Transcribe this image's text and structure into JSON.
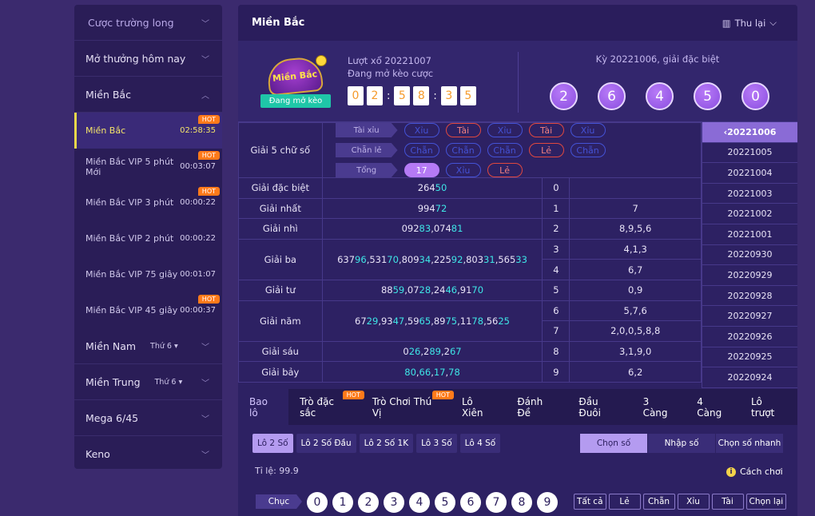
{
  "sidebar": {
    "top": "Cược trường long",
    "sections": [
      {
        "label": "Mở thưởng hôm nay"
      },
      {
        "label": "Miền Bắc"
      }
    ],
    "items": [
      {
        "name": "Miền Bắc",
        "time": "02:58:35",
        "hot": "HOT"
      },
      {
        "name": "Miền Bắc VIP 5 phút Mới",
        "time": "00:03:07",
        "hot": "HOT"
      },
      {
        "name": "Miền Bắc VIP 3 phút",
        "time": "00:00:22",
        "hot": "HOT"
      },
      {
        "name": "Miền Bắc VIP 2 phút",
        "time": "00:00:22",
        "hot": ""
      },
      {
        "name": "Miền Bắc VIP 75 giây",
        "time": "00:01:07",
        "hot": ""
      },
      {
        "name": "Miền Bắc VIP 45 giây",
        "time": "00:00:37",
        "hot": "HOT"
      }
    ],
    "bottom": [
      {
        "label": "Miền Nam",
        "dropdown": "Thứ 6"
      },
      {
        "label": "Miền Trung",
        "dropdown": "Thứ 6"
      },
      {
        "label": "Mega 6/45",
        "dropdown": ""
      },
      {
        "label": "Keno",
        "dropdown": ""
      }
    ]
  },
  "header": {
    "title": "Miền Bắc",
    "collapse": "Thu lại"
  },
  "draw": {
    "logo_text": "Miền Bắc",
    "open_label": "Đang mở kèo",
    "round": "Lượt xổ 20221007",
    "status": "Đang mở kèo cược",
    "countdown": [
      "0",
      "2",
      "5",
      "8",
      "3",
      "5"
    ],
    "prev_title": "Kỳ 20221006, giải đặc biệt",
    "prev_balls": [
      "2",
      "6",
      "4",
      "5",
      "0"
    ]
  },
  "g5": {
    "label": "Giải 5 chữ số",
    "rows": [
      {
        "label": "Tài xỉu",
        "chips": [
          {
            "t": "Xỉu",
            "c": "blue"
          },
          {
            "t": "Tài",
            "c": "red"
          },
          {
            "t": "Xỉu",
            "c": "blue"
          },
          {
            "t": "Tài",
            "c": "red"
          },
          {
            "t": "Xỉu",
            "c": "blue"
          }
        ]
      },
      {
        "label": "Chẵn lẻ",
        "chips": [
          {
            "t": "Chẵn",
            "c": "blue"
          },
          {
            "t": "Chẵn",
            "c": "blue"
          },
          {
            "t": "Chẵn",
            "c": "blue"
          },
          {
            "t": "Lẻ",
            "c": "red"
          },
          {
            "t": "Chẵn",
            "c": "blue"
          }
        ]
      },
      {
        "label": "Tổng",
        "chips": [
          {
            "t": "17",
            "c": "fill"
          },
          {
            "t": "Xỉu",
            "c": "blue"
          },
          {
            "t": "Lẻ",
            "c": "red"
          }
        ]
      }
    ]
  },
  "prizes": [
    {
      "label": "Giải đặc biệt",
      "parts": [
        [
          "264",
          "50"
        ]
      ],
      "rows": [
        {
          "d": "0",
          "t": ""
        }
      ]
    },
    {
      "label": "Giải nhất",
      "parts": [
        [
          "994",
          "72"
        ]
      ],
      "rows": [
        {
          "d": "1",
          "t": "7"
        }
      ]
    },
    {
      "label": "Giải nhì",
      "parts": [
        [
          "092",
          "83"
        ],
        [
          "074",
          "81"
        ]
      ],
      "rows": [
        {
          "d": "2",
          "t": "8,9,5,6"
        }
      ]
    },
    {
      "label": "Giải ba",
      "parts": [
        [
          "637",
          "96"
        ],
        [
          "531",
          "70"
        ],
        [
          "809",
          "34"
        ],
        [
          "225",
          "92"
        ],
        [
          "803",
          "31"
        ],
        [
          "565",
          "33"
        ]
      ],
      "rows": [
        {
          "d": "3",
          "t": "4,1,3"
        },
        {
          "d": "4",
          "t": "6,7"
        }
      ]
    },
    {
      "label": "Giải tư",
      "parts": [
        [
          "88",
          "59"
        ],
        [
          "07",
          "28"
        ],
        [
          "24",
          "46"
        ],
        [
          "91",
          "70"
        ]
      ],
      "rows": [
        {
          "d": "5",
          "t": "0,9"
        }
      ]
    },
    {
      "label": "Giải năm",
      "parts": [
        [
          "67",
          "29"
        ],
        [
          "93",
          "47"
        ],
        [
          "59",
          "65"
        ],
        [
          "89",
          "75"
        ],
        [
          "11",
          "78"
        ],
        [
          "56",
          "25"
        ]
      ],
      "rows": [
        {
          "d": "6",
          "t": "5,7,6"
        },
        {
          "d": "7",
          "t": "2,0,0,5,8,8"
        }
      ]
    },
    {
      "label": "Giải sáu",
      "parts": [
        [
          "0",
          "26"
        ],
        [
          "2",
          "89"
        ],
        [
          "2",
          "67"
        ]
      ],
      "rows": [
        {
          "d": "8",
          "t": "3,1,9,0"
        }
      ]
    },
    {
      "label": "Giải bảy",
      "parts": [
        [
          "",
          "80"
        ],
        [
          "",
          "66"
        ],
        [
          "",
          "17"
        ],
        [
          "",
          "78"
        ]
      ],
      "rows": [
        {
          "d": "9",
          "t": "6,2"
        }
      ]
    }
  ],
  "periods": [
    "20221006",
    "20221005",
    "20221004",
    "20221003",
    "20221002",
    "20221001",
    "20220930",
    "20220929",
    "20220928",
    "20220927",
    "20220926",
    "20220925",
    "20220924"
  ],
  "tabs": [
    {
      "label": "Bao lô",
      "hot": ""
    },
    {
      "label": "Trò đặc sắc",
      "hot": "HOT"
    },
    {
      "label": "Trò Chơi Thú Vị",
      "hot": "HOT"
    },
    {
      "label": "Lô Xiên",
      "hot": ""
    },
    {
      "label": "Đánh Đề",
      "hot": ""
    },
    {
      "label": "Đầu Đuôi",
      "hot": ""
    },
    {
      "label": "3 Càng",
      "hot": ""
    },
    {
      "label": "4 Càng",
      "hot": ""
    },
    {
      "label": "Lô trượt",
      "hot": ""
    }
  ],
  "subtabs": [
    "Lô 2 Số",
    "Lô 2 Số Đầu",
    "Lô 2 Số 1K",
    "Lô 3 Số",
    "Lô 4 Số"
  ],
  "modes": [
    "Chọn số",
    "Nhập số",
    "Chọn số nhanh"
  ],
  "rate": "Tỉ lệ:  99.9",
  "howto": "Cách chơi",
  "chuc": "Chục",
  "digits": [
    "0",
    "1",
    "2",
    "3",
    "4",
    "5",
    "6",
    "7",
    "8",
    "9"
  ],
  "quick": [
    "Tất cả",
    "Lẻ",
    "Chẵn",
    "Xỉu",
    "Tài",
    "Chọn lại"
  ]
}
